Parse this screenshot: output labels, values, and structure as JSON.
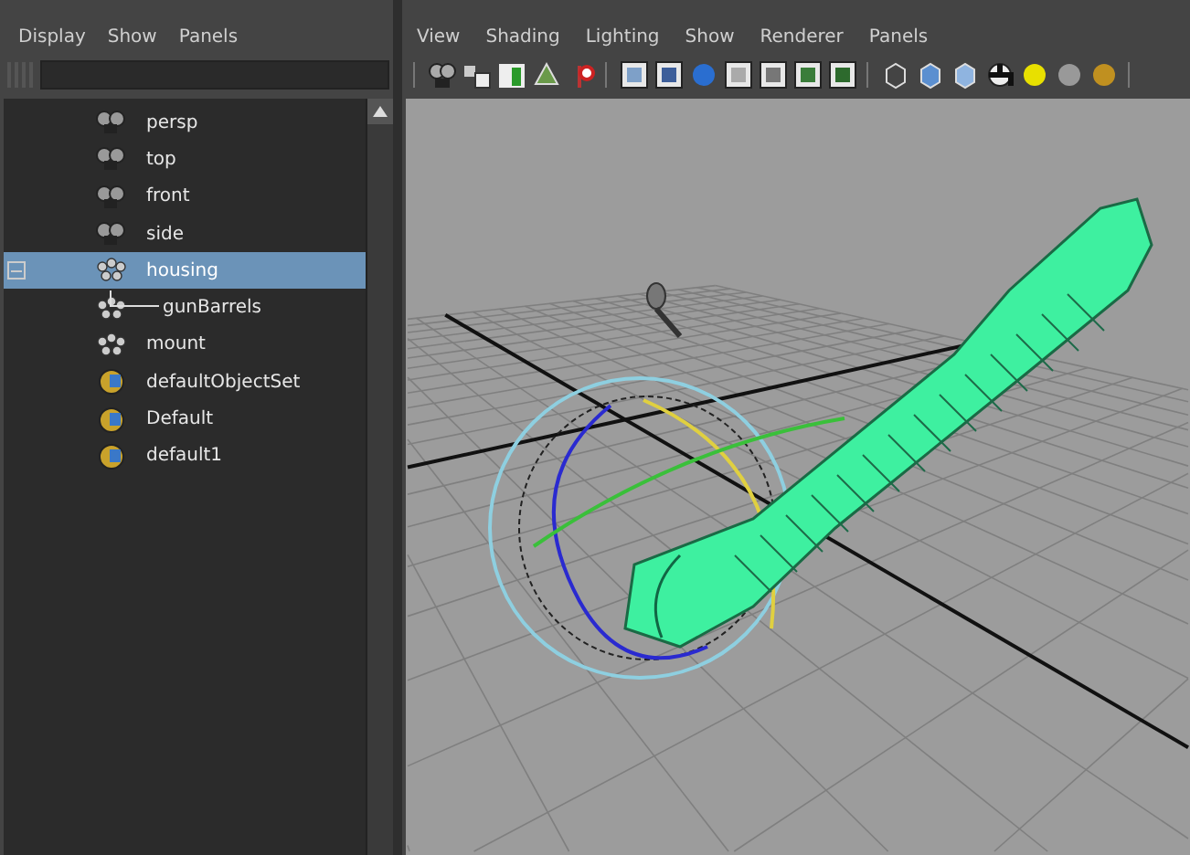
{
  "outliner": {
    "menu": [
      "Display",
      "Show",
      "Panels"
    ],
    "items": [
      {
        "label": "persp",
        "kind": "camera",
        "selected": false
      },
      {
        "label": "top",
        "kind": "camera",
        "selected": false
      },
      {
        "label": "front",
        "kind": "camera",
        "selected": false
      },
      {
        "label": "side",
        "kind": "camera",
        "selected": false
      },
      {
        "label": "housing",
        "kind": "group",
        "selected": true,
        "expanded": true,
        "children": [
          {
            "label": "gunBarrels",
            "kind": "group",
            "selected": false
          }
        ]
      },
      {
        "label": "mount",
        "kind": "group",
        "selected": false
      },
      {
        "label": "defaultObjectSet",
        "kind": "set",
        "selected": false
      },
      {
        "label": "Default",
        "kind": "set",
        "selected": false
      },
      {
        "label": "default1",
        "kind": "set",
        "selected": false
      }
    ]
  },
  "viewport": {
    "menu": [
      "View",
      "Shading",
      "Lighting",
      "Show",
      "Renderer",
      "Panels"
    ]
  }
}
